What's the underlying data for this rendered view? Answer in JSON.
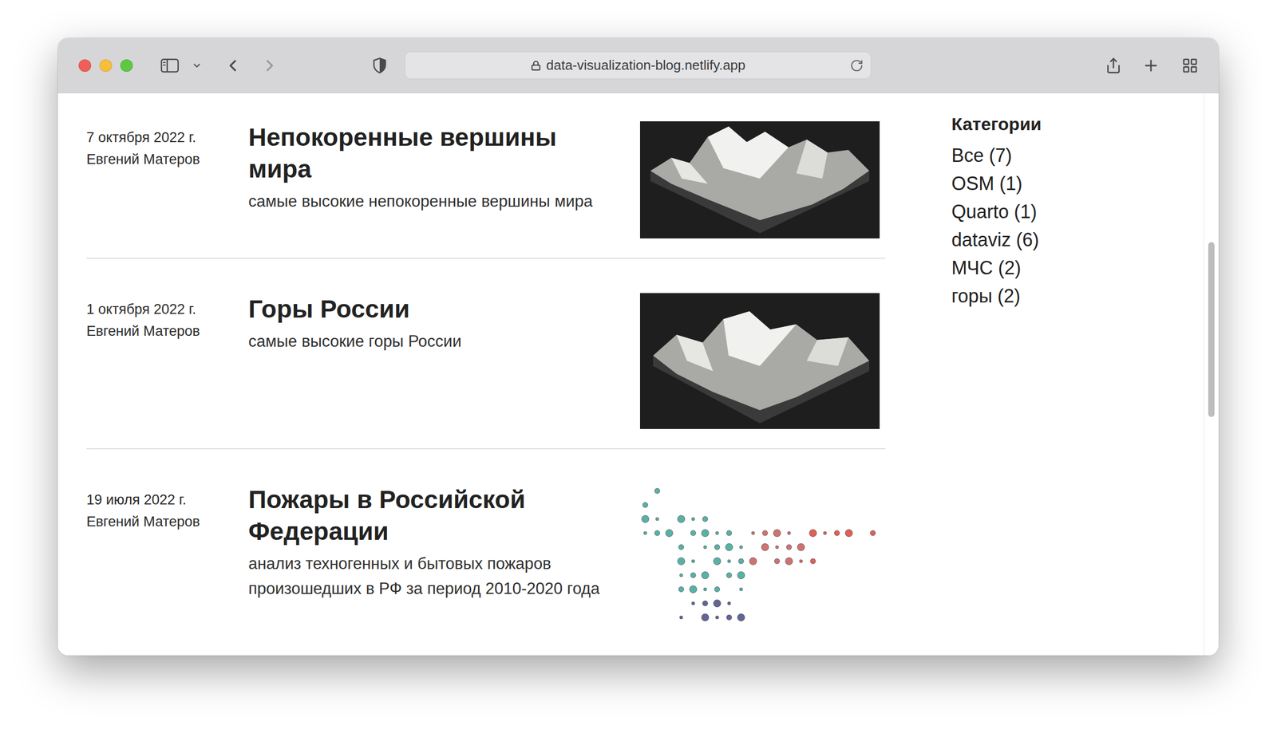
{
  "browser": {
    "url": "data-visualization-blog.netlify.app"
  },
  "posts": [
    {
      "date": "7 октября 2022 г.",
      "author": "Евгений Матеров",
      "title": "Непокоренные вершины мира",
      "description": "самые высокие непокоренные вершины мира",
      "kind": "terrain"
    },
    {
      "date": "1 октября 2022 г.",
      "author": "Евгений Матеров",
      "title": "Горы России",
      "description": "самые высокие горы России",
      "kind": "terrain"
    },
    {
      "date": "19 июля 2022 г.",
      "author": "Евгений Матеров",
      "title": "Пожары в Российской Федерации",
      "description": "анализ техногенных и бытовых пожаров произошедших в РФ за период 2010-2020 года",
      "kind": "dotmap"
    }
  ],
  "categories": {
    "title": "Категории",
    "items": [
      {
        "label": "Все (7)"
      },
      {
        "label": "OSM (1)"
      },
      {
        "label": "Quarto (1)"
      },
      {
        "label": "dataviz (6)"
      },
      {
        "label": "МЧС (2)"
      },
      {
        "label": "горы (2)"
      }
    ]
  }
}
